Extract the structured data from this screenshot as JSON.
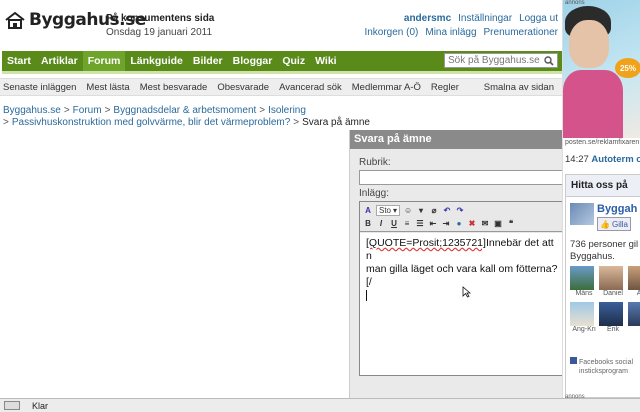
{
  "header": {
    "logo_text": "Byggahus.se",
    "tagline": "På konsumentens sida",
    "date": "Onsdag 19 januari 2011",
    "username": "andersmc",
    "settings": "Inställningar",
    "logout": "Logga ut",
    "inbox": "Inkorgen (0)",
    "my_posts": "Mina inlägg",
    "subscribe": "Prenumerationer"
  },
  "nav": {
    "items": [
      "Start",
      "Artiklar",
      "Forum",
      "Länkguide",
      "Bilder",
      "Bloggar",
      "Quiz",
      "Wiki"
    ],
    "active": "Forum",
    "search_placeholder": "Sök på Byggahus.se"
  },
  "subnav": {
    "items": [
      "Senaste inläggen",
      "Mest lästa",
      "Mest besvarade",
      "Obesvarade",
      "Avancerad sök",
      "Medlemmar A-Ö",
      "Regler"
    ],
    "right": "Smalna av sidan"
  },
  "breadcrumb": {
    "items": [
      "Byggahus.se",
      "Forum",
      "Byggnadsdelar & arbetsmoment",
      "Isolering"
    ],
    "thread": "Passivhuskonstruktion med golvvärme, blir det värmeproblem?",
    "current": "Svara på ämne"
  },
  "reply": {
    "title": "Svara på ämne",
    "subject_label": "Rubrik:",
    "post_label": "Inlägg:",
    "font_select": "Sto",
    "body_quote": "[QUOTE=Prosit;1235721]",
    "body_line1": "Innebär det att n",
    "body_line2": "man gilla läget och vara kall om fötterna?[/"
  },
  "ad": {
    "label_top": "annons",
    "badge": "25%",
    "url": "posten.se/reklamfixaren",
    "label_bottom": "annons"
  },
  "news": {
    "time": "14:27",
    "headline": "Autoterm o"
  },
  "facebook": {
    "title": "Hitta oss på",
    "page_name": "Byggah",
    "like_label": "Gilla",
    "count_line1": "736 personer gil",
    "count_line2": "Byggahus.",
    "faces": [
      "Måns",
      "Daniel",
      "Am",
      "Ang-Kri",
      "Erik",
      "P"
    ],
    "footer_line1": "Facebooks social",
    "footer_line2": "insticksprogram"
  },
  "statusbar": {
    "status": "Klar"
  }
}
